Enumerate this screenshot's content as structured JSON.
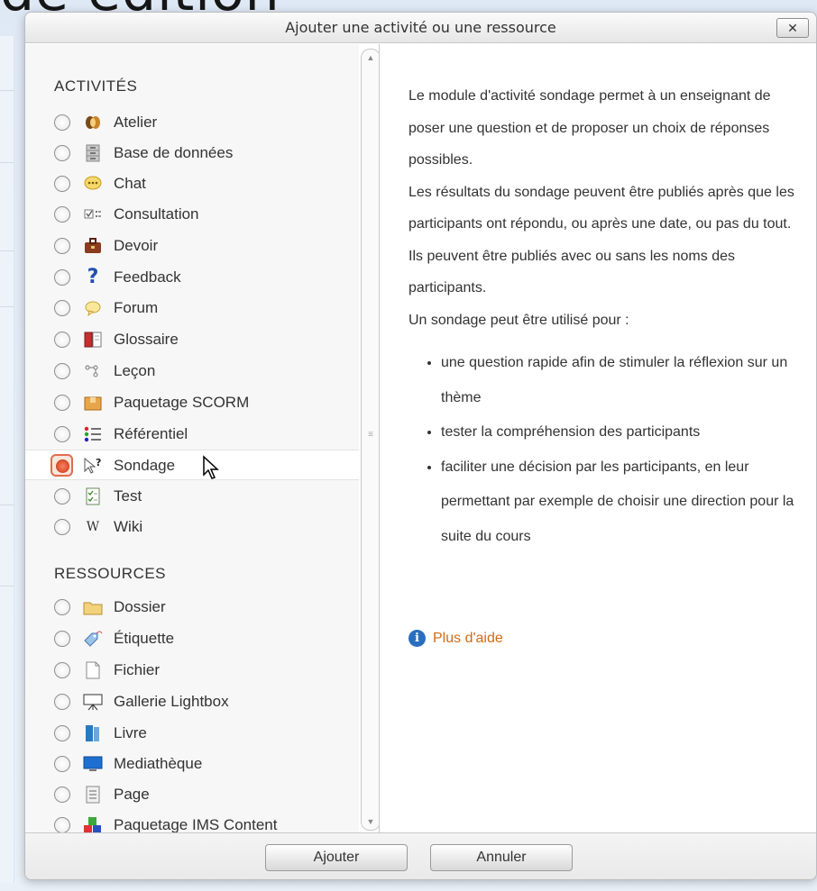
{
  "background": {
    "heading_fragment": "de édition"
  },
  "dialog": {
    "title": "Ajouter une activité ou une ressource",
    "close_label": "✕",
    "selected_module": "Sondage"
  },
  "activities": {
    "section_label": "ACTIVITÉS",
    "items": [
      {
        "label": "Atelier",
        "icon": "workshop-icon"
      },
      {
        "label": "Base de données",
        "icon": "database-icon"
      },
      {
        "label": "Chat",
        "icon": "chat-icon"
      },
      {
        "label": "Consultation",
        "icon": "consultation-icon"
      },
      {
        "label": "Devoir",
        "icon": "assignment-icon"
      },
      {
        "label": "Feedback",
        "icon": "feedback-icon"
      },
      {
        "label": "Forum",
        "icon": "forum-icon"
      },
      {
        "label": "Glossaire",
        "icon": "glossary-icon"
      },
      {
        "label": "Leçon",
        "icon": "lesson-icon"
      },
      {
        "label": "Paquetage SCORM",
        "icon": "scorm-icon"
      },
      {
        "label": "Référentiel",
        "icon": "referential-icon"
      },
      {
        "label": "Sondage",
        "icon": "choice-icon"
      },
      {
        "label": "Test",
        "icon": "quiz-icon"
      },
      {
        "label": "Wiki",
        "icon": "wiki-icon"
      }
    ]
  },
  "resources": {
    "section_label": "RESSOURCES",
    "items": [
      {
        "label": "Dossier",
        "icon": "folder-icon"
      },
      {
        "label": "Étiquette",
        "icon": "label-icon"
      },
      {
        "label": "Fichier",
        "icon": "file-icon"
      },
      {
        "label": "Gallerie Lightbox",
        "icon": "lightbox-gallery-icon"
      },
      {
        "label": "Livre",
        "icon": "book-icon"
      },
      {
        "label": "Mediathèque",
        "icon": "media-library-icon"
      },
      {
        "label": "Page",
        "icon": "page-icon"
      },
      {
        "label": "Paquetage IMS Content",
        "icon": "ims-package-icon"
      }
    ]
  },
  "description": {
    "intro": "Le module d'activité sondage permet à un enseignant de poser une question et de proposer un choix de réponses possibles.",
    "details": "Les résultats du sondage peuvent être publiés après que les participants ont répondu, ou après une date, ou pas du tout. Ils peuvent être publiés avec ou sans les noms des participants.",
    "usage_intro": "Un sondage peut être utilisé pour :",
    "uses": [
      "une question rapide afin de stimuler la réflexion sur un thème",
      "tester la compréhension des participants",
      "faciliter une décision par les participants, en leur permettant par exemple de choisir une direction pour la suite du cours"
    ],
    "help_link": "Plus d'aide"
  },
  "footer": {
    "add_label": "Ajouter",
    "cancel_label": "Annuler"
  },
  "colors": {
    "accent_radio": "#e36b4c",
    "help_link": "#d26a13",
    "info_icon": "#2a6fbf"
  }
}
